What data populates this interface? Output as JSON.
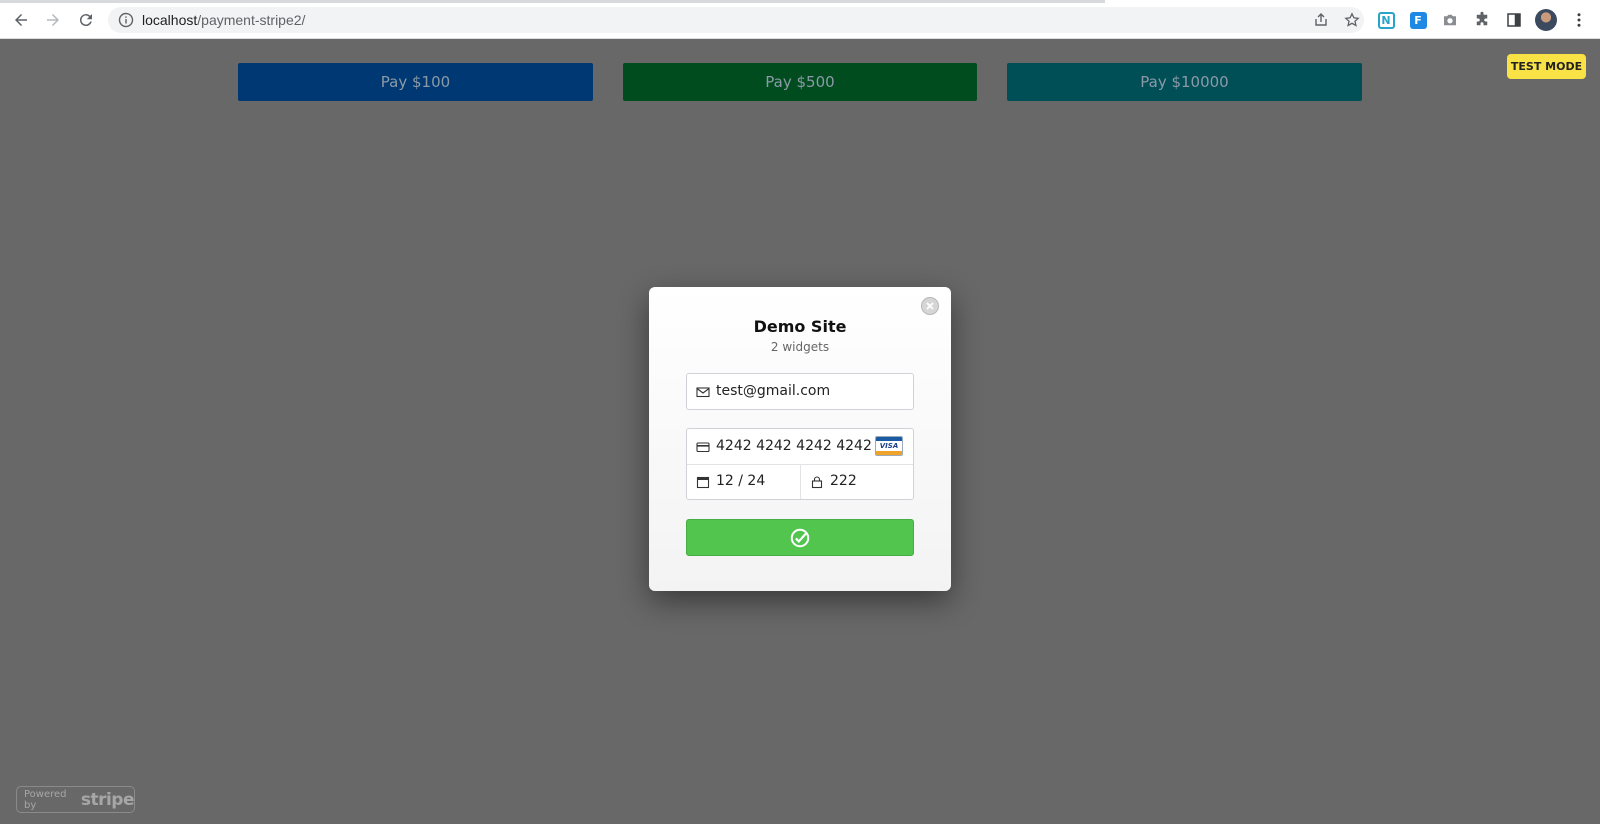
{
  "browser": {
    "url_host": "localhost",
    "url_path": "/payment-stripe2/",
    "extensions": [
      {
        "name": "notion-extension-icon",
        "text": "N",
        "color": "#2aa3c9"
      },
      {
        "name": "flow-extension-icon",
        "text": "F",
        "color": "#1e88e5"
      }
    ]
  },
  "page": {
    "buttons": [
      {
        "label": "Pay $100",
        "color": "#003873"
      },
      {
        "label": "Pay $500",
        "color": "#004c1f"
      },
      {
        "label": "Pay $10000",
        "color": "#004e56"
      }
    ],
    "test_mode_label": "TEST MODE",
    "powered_by": {
      "prefix": "Powered by",
      "brand": "stripe"
    }
  },
  "checkout": {
    "title": "Demo Site",
    "subtitle": "2 widgets",
    "email": "test@gmail.com",
    "card_number": "4242 4242 4242 4242",
    "card_brand": "VISA",
    "expiry": "12 / 24",
    "cvc": "222",
    "submit_color": "#52c54f"
  }
}
